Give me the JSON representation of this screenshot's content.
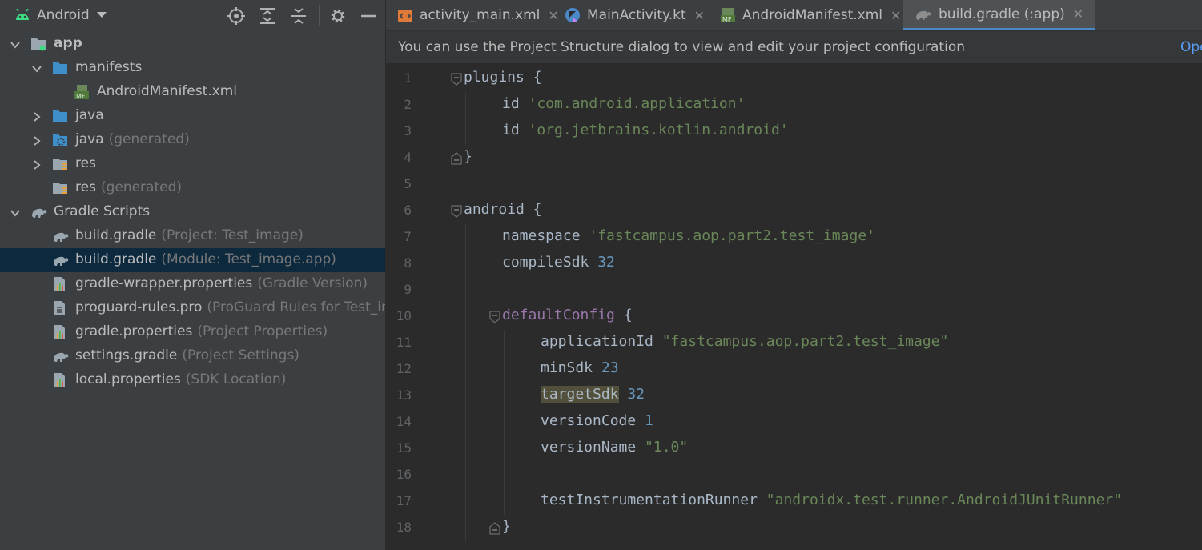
{
  "project_panel": {
    "view_selector": "Android",
    "toolbar_icons": [
      "locate-icon",
      "expand-all-icon",
      "collapse-all-icon",
      "gear-icon",
      "minimize-icon"
    ],
    "tree": [
      {
        "label": "app",
        "sub": "",
        "level": 0,
        "chevron": "down",
        "icon": "module-folder-icon",
        "bold": true
      },
      {
        "label": "manifests",
        "sub": "",
        "level": 1,
        "chevron": "down",
        "icon": "folder-icon"
      },
      {
        "label": "AndroidManifest.xml",
        "sub": "",
        "level": 2,
        "chevron": "",
        "icon": "manifest-file-icon"
      },
      {
        "label": "java",
        "sub": "",
        "level": 1,
        "chevron": "right",
        "icon": "folder-icon"
      },
      {
        "label": "java",
        "sub": "(generated)",
        "level": 1,
        "chevron": "right",
        "icon": "generated-folder-icon"
      },
      {
        "label": "res",
        "sub": "",
        "level": 1,
        "chevron": "right",
        "icon": "res-folder-icon"
      },
      {
        "label": "res",
        "sub": "(generated)",
        "level": 1,
        "chevron": "",
        "icon": "res-folder-icon"
      },
      {
        "label": "Gradle Scripts",
        "sub": "",
        "level": 0,
        "chevron": "down",
        "icon": "gradle-icon"
      },
      {
        "label": "build.gradle",
        "sub": "(Project: Test_image)",
        "level": 1,
        "chevron": "",
        "icon": "gradle-icon"
      },
      {
        "label": "build.gradle",
        "sub": "(Module: Test_image.app)",
        "level": 1,
        "chevron": "",
        "icon": "gradle-icon",
        "selected": true
      },
      {
        "label": "gradle-wrapper.properties",
        "sub": "(Gradle Version)",
        "level": 1,
        "chevron": "",
        "icon": "properties-file-icon"
      },
      {
        "label": "proguard-rules.pro",
        "sub": "(ProGuard Rules for Test_im",
        "level": 1,
        "chevron": "",
        "icon": "text-file-icon"
      },
      {
        "label": "gradle.properties",
        "sub": "(Project Properties)",
        "level": 1,
        "chevron": "",
        "icon": "properties-file-icon"
      },
      {
        "label": "settings.gradle",
        "sub": "(Project Settings)",
        "level": 1,
        "chevron": "",
        "icon": "gradle-icon"
      },
      {
        "label": "local.properties",
        "sub": "(SDK Location)",
        "level": 1,
        "chevron": "",
        "icon": "properties-file-icon"
      }
    ]
  },
  "tabs": [
    {
      "label": "activity_main.xml",
      "icon": "xml-file-icon",
      "active": false
    },
    {
      "label": "MainActivity.kt",
      "icon": "kotlin-file-icon",
      "active": false
    },
    {
      "label": "AndroidManifest.xml",
      "icon": "manifest-file-icon",
      "active": false
    },
    {
      "label": "build.gradle (:app)",
      "icon": "gradle-icon",
      "active": true
    }
  ],
  "notice": {
    "text": "You can use the Project Structure dialog to view and edit your project configuration",
    "link": "Ope"
  },
  "code_lines": [
    {
      "n": "1",
      "indent": 0,
      "fold": "open",
      "tokens": [
        [
          "kw",
          "plugins {"
        ]
      ]
    },
    {
      "n": "2",
      "indent": 1,
      "tokens": [
        [
          "kw",
          "id "
        ],
        [
          "str",
          "'com.android.application'"
        ]
      ]
    },
    {
      "n": "3",
      "indent": 1,
      "tokens": [
        [
          "kw",
          "id "
        ],
        [
          "str",
          "'org.jetbrains.kotlin.android'"
        ]
      ]
    },
    {
      "n": "4",
      "indent": 0,
      "fold": "close",
      "tokens": [
        [
          "kw",
          "}"
        ]
      ]
    },
    {
      "n": "5",
      "indent": 0,
      "tokens": []
    },
    {
      "n": "6",
      "indent": 0,
      "fold": "open",
      "tokens": [
        [
          "kw",
          "android {"
        ]
      ]
    },
    {
      "n": "7",
      "indent": 1,
      "tokens": [
        [
          "kw",
          "namespace "
        ],
        [
          "str",
          "'fastcampus.aop.part2.test_image'"
        ]
      ]
    },
    {
      "n": "8",
      "indent": 1,
      "tokens": [
        [
          "kw",
          "compileSdk "
        ],
        [
          "num",
          "32"
        ]
      ]
    },
    {
      "n": "9",
      "indent": 0,
      "tokens": []
    },
    {
      "n": "10",
      "indent": 1,
      "fold": "open",
      "tokens": [
        [
          "method",
          "defaultConfig"
        ],
        [
          "kw",
          " {"
        ]
      ]
    },
    {
      "n": "11",
      "indent": 2,
      "tokens": [
        [
          "kw",
          "applicationId "
        ],
        [
          "str",
          "\"fastcampus.aop.part2.test_image\""
        ]
      ]
    },
    {
      "n": "12",
      "indent": 2,
      "tokens": [
        [
          "kw",
          "minSdk "
        ],
        [
          "num",
          "23"
        ]
      ]
    },
    {
      "n": "13",
      "indent": 2,
      "tokens": [
        [
          "hl",
          "targetSdk"
        ],
        [
          "kw",
          " "
        ],
        [
          "num",
          "32"
        ]
      ]
    },
    {
      "n": "14",
      "indent": 2,
      "tokens": [
        [
          "kw",
          "versionCode "
        ],
        [
          "num",
          "1"
        ]
      ]
    },
    {
      "n": "15",
      "indent": 2,
      "tokens": [
        [
          "kw",
          "versionName "
        ],
        [
          "str",
          "\"1.0\""
        ]
      ]
    },
    {
      "n": "16",
      "indent": 0,
      "tokens": []
    },
    {
      "n": "17",
      "indent": 2,
      "tokens": [
        [
          "kw",
          "testInstrumentationRunner "
        ],
        [
          "str",
          "\"androidx.test.runner.AndroidJUnitRunner\""
        ]
      ]
    },
    {
      "n": "18",
      "indent": 1,
      "fold": "close",
      "tokens": [
        [
          "kw",
          "}"
        ]
      ]
    }
  ],
  "colors": {
    "panel_bg": "#3c3f41",
    "editor_bg": "#2b2b2b",
    "selection_bg": "#0d293e",
    "string": "#6a8759",
    "number": "#6897bb",
    "method": "#9876aa",
    "text": "#a9b7c6",
    "link": "#589df6"
  }
}
